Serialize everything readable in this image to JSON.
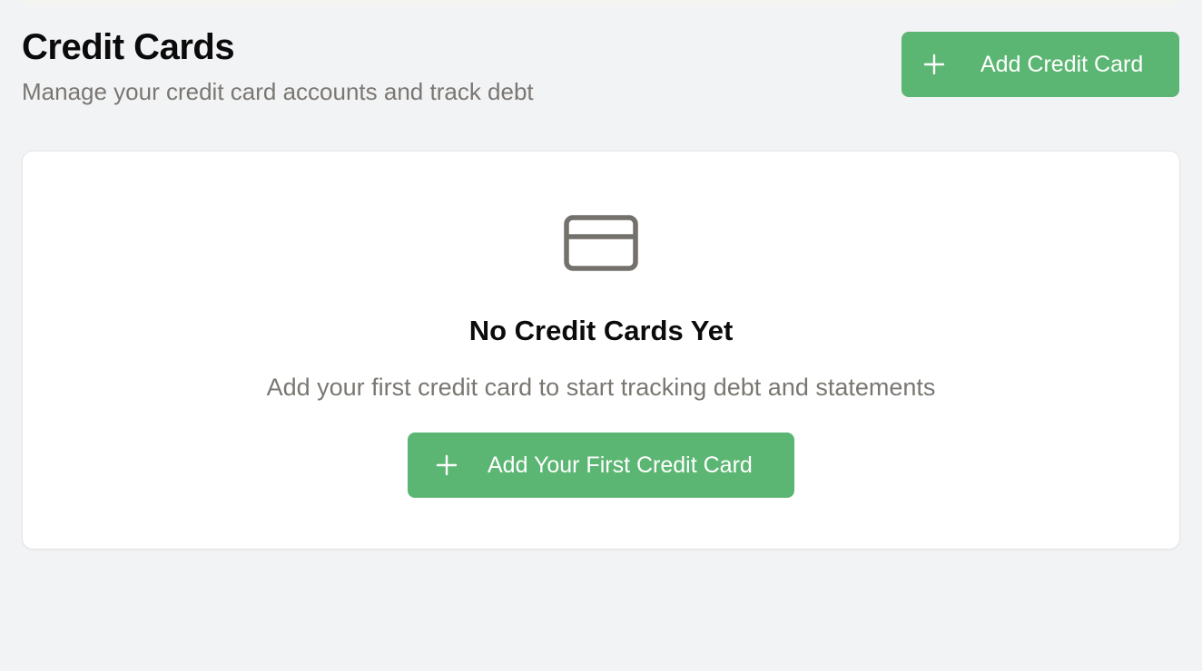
{
  "header": {
    "title": "Credit Cards",
    "subtitle": "Manage your credit card accounts and track debt",
    "add_button_label": "Add Credit Card"
  },
  "empty_state": {
    "icon": "credit-card-icon",
    "title": "No Credit Cards Yet",
    "description": "Add your first credit card to start tracking debt and statements",
    "button_label": "Add Your First Credit Card"
  },
  "colors": {
    "accent": "#5cb673",
    "background": "#f2f3f5",
    "muted_text": "#7a7772",
    "icon": "#74706b"
  }
}
